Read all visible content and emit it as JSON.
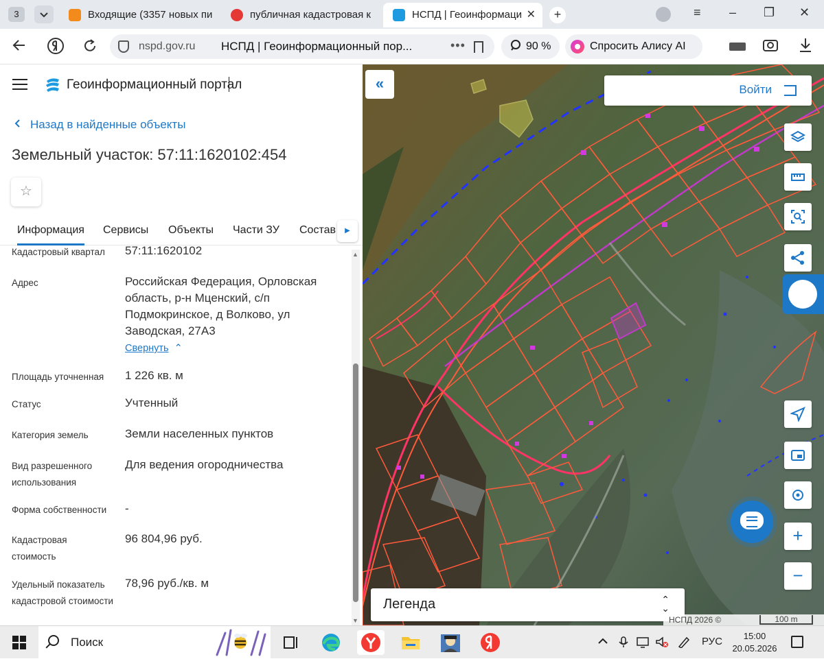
{
  "browser": {
    "tab_count": "3",
    "tabs": [
      {
        "label": "Входящие (3357 новых пи",
        "icon": "mail-icon",
        "color": "#f28b1b"
      },
      {
        "label": "публичная кадастровая к",
        "icon": "yandex-icon",
        "color": "#e53935"
      },
      {
        "label": "НСПД | Геоинформаци",
        "icon": "nspd-icon",
        "color": "#1e9be0"
      }
    ],
    "new_tab_label": "+",
    "window_buttons": [
      "≡",
      "–",
      "❐",
      "✕"
    ]
  },
  "addressbar": {
    "domain": "nspd.gov.ru",
    "page_title": "НСПД | Геоинформационный пор...",
    "dots": "•••",
    "zoom": "90 %",
    "alisa_label": "Спросить Алису AI"
  },
  "portal": {
    "title": "Геоинформационный портал",
    "back_label": "Назад в найденные объекты",
    "object_title": "Земельный участок: 57:11:1620102:454",
    "star": "☆",
    "tabs": [
      "Информация",
      "Сервисы",
      "Объекты",
      "Части ЗУ",
      "Состав"
    ],
    "tabs_more": "▶"
  },
  "properties": [
    {
      "label": "Кадастровый квартал",
      "value": "57:11:1620102"
    },
    {
      "label": "Адрес",
      "value": "Российская Федерация, Орловская область, р-н Мценский, с/п Подмокринское, д Волково, ул Заводская, 27А3"
    },
    {
      "label": "Площадь уточненная",
      "value": "1 226 кв. м"
    },
    {
      "label": "Статус",
      "value": "Учтенный"
    },
    {
      "label": "Категория земель",
      "value": "Земли населенных пунктов"
    },
    {
      "label": "Вид разрешенного использования",
      "value": "Для ведения огородничества"
    },
    {
      "label": "Форма собственности",
      "value": "-"
    },
    {
      "label": "Кадастровая стоимость",
      "value": "96 804,96 руб."
    },
    {
      "label": "Удельный показатель кадастровой стоимости",
      "value": "78,96 руб./кв. м"
    }
  ],
  "collapse_label": "Свернуть",
  "map": {
    "login_label": "Войти",
    "collapse_icon": "«",
    "tools": [
      "layers-icon",
      "ruler-icon",
      "search-area-icon",
      "share-icon"
    ],
    "nav_tools": [
      "locate-icon",
      "fullscreen-icon",
      "target-icon"
    ],
    "zoom_in": "+",
    "zoom_out": "−",
    "legend_label": "Легенда",
    "legend_toggle": "⌃⌄",
    "attribution": "НСПД 2026 ©",
    "scale_label": "100 m",
    "colors": {
      "parcel": "#ff5a3c",
      "road": "#ff3366",
      "selected": "#c03ac8",
      "boundary": "#2233ff"
    }
  },
  "taskbar": {
    "search_placeholder": "Поиск",
    "apps": [
      "taskview-icon",
      "edge-icon",
      "yandex-browser-icon",
      "explorer-icon",
      "app-icon",
      "yandex-icon"
    ],
    "tray": [
      "chevron-up-icon",
      "mic-icon",
      "display-icon",
      "volume-icon",
      "pen-icon"
    ],
    "lang": "РУС",
    "time": "15:00",
    "date": "20.05.2026"
  }
}
